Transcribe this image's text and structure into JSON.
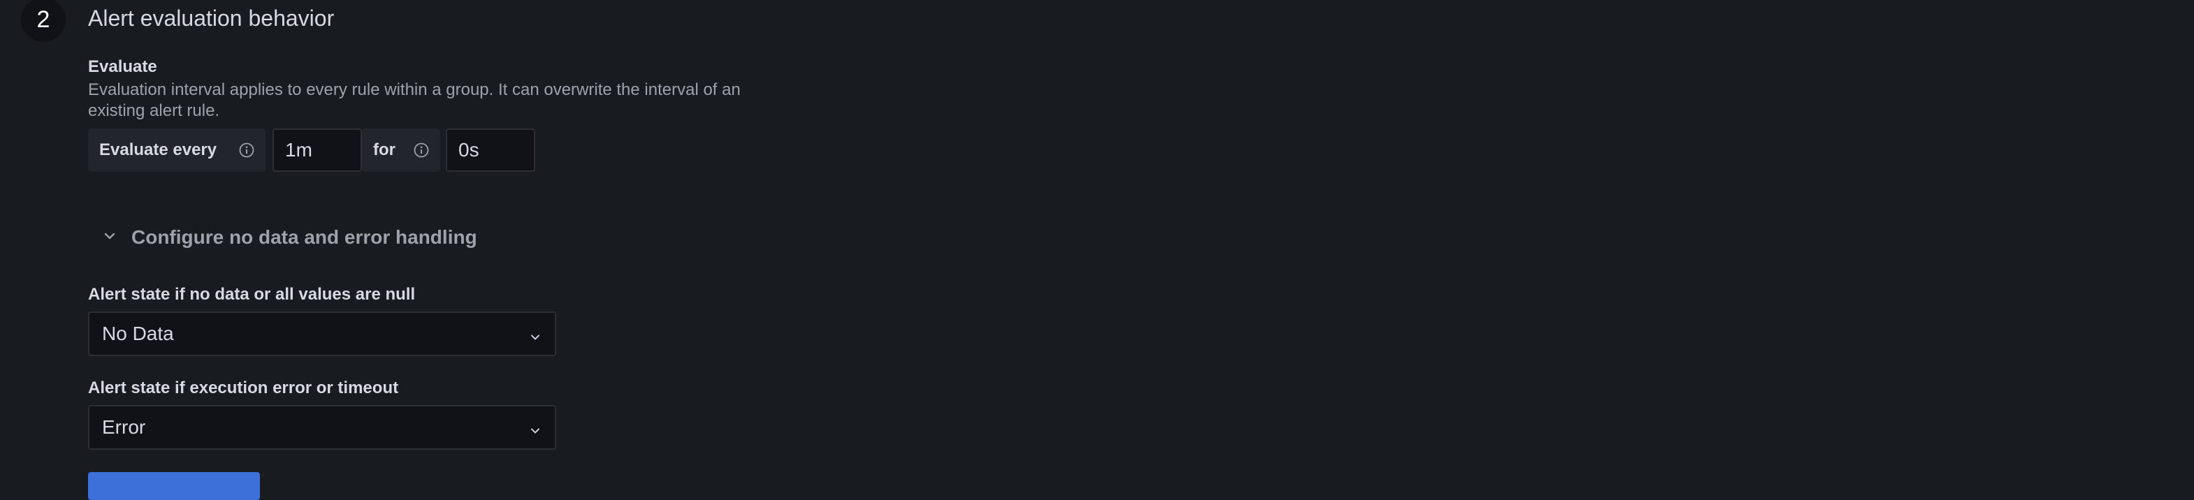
{
  "section": {
    "step_number": "2",
    "title": "Alert evaluation behavior"
  },
  "evaluate": {
    "label": "Evaluate",
    "description": "Evaluation interval applies to every rule within a group. It can overwrite the interval of an existing alert rule.",
    "every_label": "Evaluate every",
    "every_value": "1m",
    "for_label": "for",
    "for_value": "0s",
    "info_icon": "info-circle-icon"
  },
  "no_data_section": {
    "toggle_label": "Configure no data and error handling",
    "toggle_icon": "chevron-down-icon"
  },
  "no_data_state": {
    "label": "Alert state if no data or all values are null",
    "value": "No Data"
  },
  "error_state": {
    "label": "Alert state if execution error or timeout",
    "value": "Error"
  },
  "colors": {
    "background": "#181b1f",
    "input_background": "#111217",
    "addon_background": "#22252b",
    "primary_button": "#3d71d9"
  }
}
